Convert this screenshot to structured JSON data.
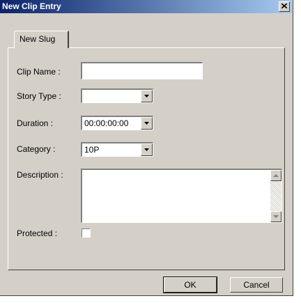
{
  "window": {
    "title": "New Clip Entry"
  },
  "tabs": [
    {
      "label": "New Slug"
    }
  ],
  "form": {
    "clip_name": {
      "label": "Clip Name :",
      "value": ""
    },
    "story_type": {
      "label": "Story Type :",
      "value": ""
    },
    "duration": {
      "label": "Duration :",
      "value": "00:00:00:00"
    },
    "category": {
      "label": "Category :",
      "value": "10P"
    },
    "description": {
      "label": "Description :",
      "value": ""
    },
    "protected": {
      "label": "Protected :",
      "checked": false
    }
  },
  "buttons": {
    "ok": "OK",
    "cancel": "Cancel"
  }
}
